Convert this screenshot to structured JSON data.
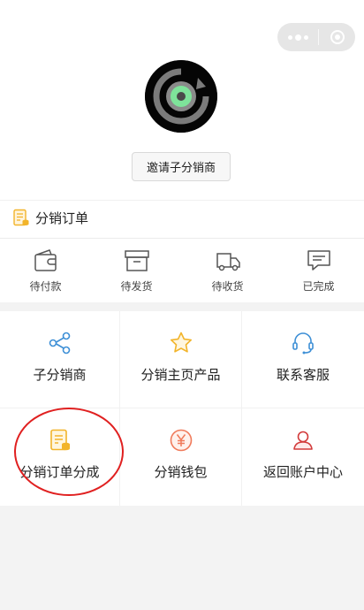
{
  "header": {
    "invite_button": "邀请子分销商"
  },
  "orders": {
    "title": "分销订单",
    "statuses": [
      {
        "label": "待付款",
        "icon": "wallet-icon"
      },
      {
        "label": "待发货",
        "icon": "box-icon"
      },
      {
        "label": "待收货",
        "icon": "truck-icon"
      },
      {
        "label": "已完成",
        "icon": "message-icon"
      }
    ]
  },
  "grid": [
    {
      "label": "子分销商",
      "icon": "share-icon",
      "color": "#3d8fd6"
    },
    {
      "label": "分销主页产品",
      "icon": "star-icon",
      "color": "#f2b42a"
    },
    {
      "label": "联系客服",
      "icon": "headset-icon",
      "color": "#3d8fd6"
    },
    {
      "label": "分销订单分成",
      "icon": "order-list-icon",
      "color": "#f2b42a"
    },
    {
      "label": "分销钱包",
      "icon": "yen-coin-icon",
      "color": "#f07a5a"
    },
    {
      "label": "返回账户中心",
      "icon": "user-icon",
      "color": "#d23b3b"
    }
  ],
  "colors": {
    "accent_orange": "#f2b42a",
    "accent_blue": "#3d8fd6",
    "annotation_red": "#e02020"
  }
}
